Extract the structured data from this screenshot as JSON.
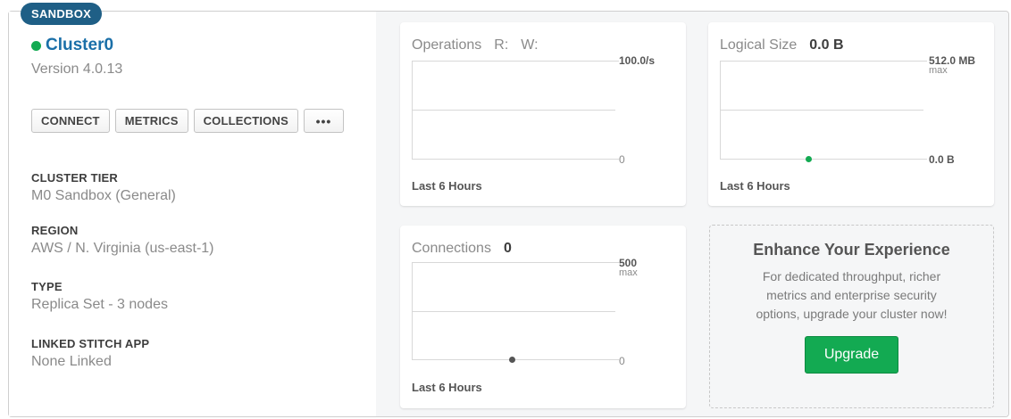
{
  "badge": "SANDBOX",
  "cluster": {
    "name": "Cluster0",
    "status_color": "#13aa52",
    "version": "Version 4.0.13"
  },
  "buttons": {
    "connect": "CONNECT",
    "metrics": "METRICS",
    "collections": "COLLECTIONS",
    "more": "•••"
  },
  "info": [
    {
      "label": "CLUSTER TIER",
      "value": "M0 Sandbox (General)"
    },
    {
      "label": "REGION",
      "value": "AWS / N. Virginia (us-east-1)"
    },
    {
      "label": "TYPE",
      "value": "Replica Set - 3 nodes"
    },
    {
      "label": "LINKED STITCH APP",
      "value": "None Linked"
    }
  ],
  "operations": {
    "title": "Operations",
    "r_label": "R:",
    "w_label": "W:",
    "max": "100.0/s",
    "min": "0",
    "footer": "Last 6 Hours"
  },
  "logical_size": {
    "title": "Logical Size",
    "value": "0.0 B",
    "max": "512.0 MB",
    "max_sub": "max",
    "min": "0.0 B",
    "footer": "Last 6 Hours",
    "point_color": "#13aa52"
  },
  "connections": {
    "title": "Connections",
    "value": "0",
    "max": "500",
    "max_sub": "max",
    "min": "0",
    "footer": "Last 6 Hours",
    "point_color": "#555555"
  },
  "promo": {
    "title": "Enhance Your Experience",
    "text": "For dedicated throughput, richer metrics and enterprise security options, upgrade your cluster now!",
    "button": "Upgrade"
  }
}
